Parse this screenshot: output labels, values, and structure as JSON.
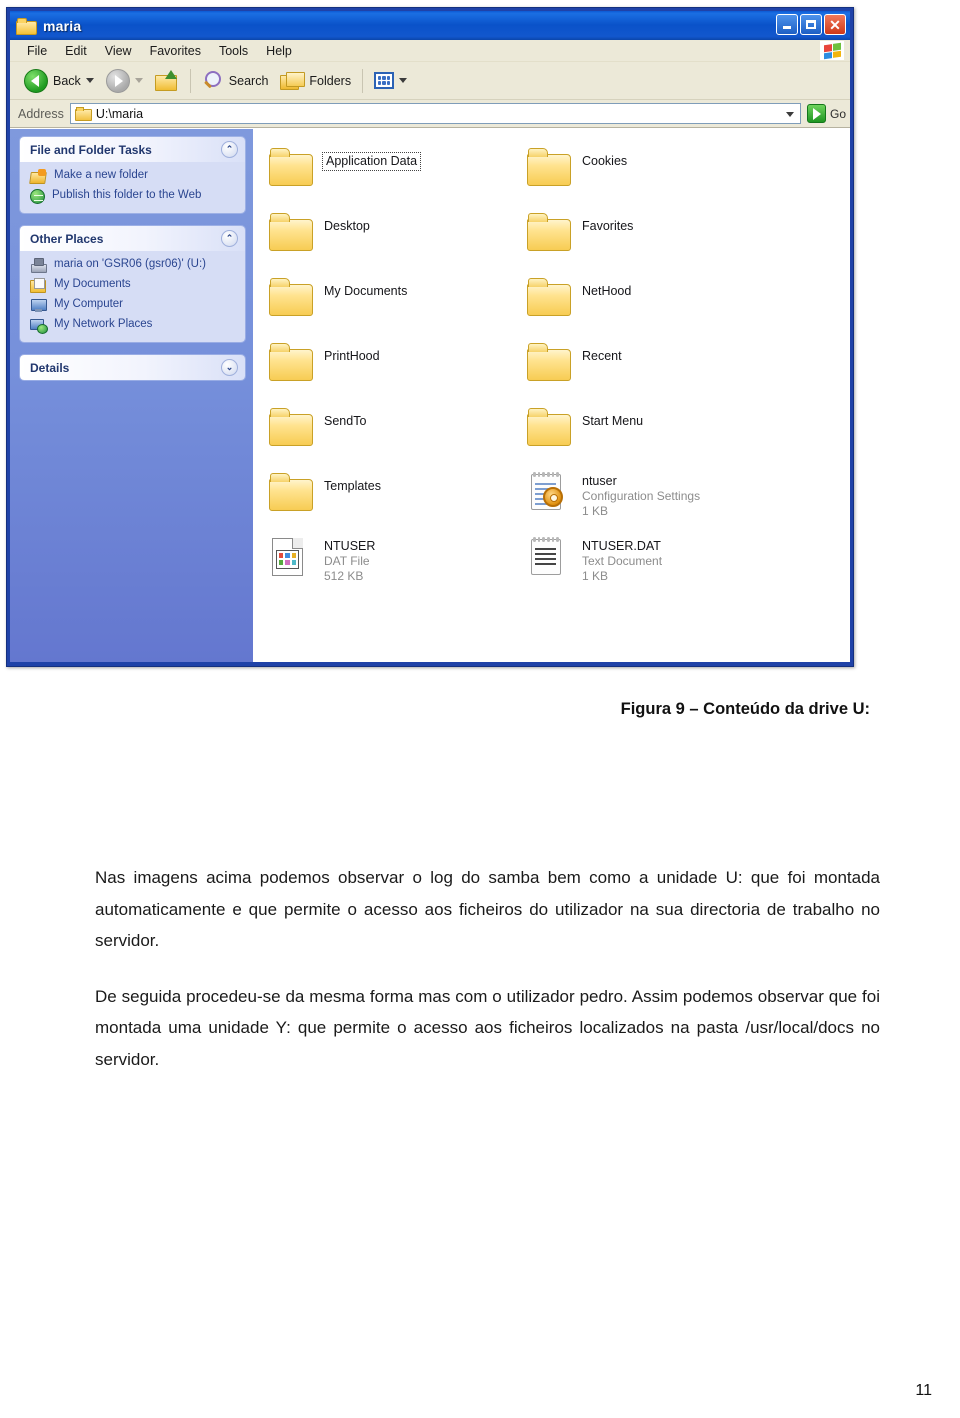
{
  "window": {
    "title": "maria",
    "controls": {
      "minimize": "–",
      "maximize": "□",
      "close": "✕"
    },
    "menus": [
      "File",
      "Edit",
      "View",
      "Favorites",
      "Tools",
      "Help"
    ],
    "toolbar": {
      "back": "Back",
      "search": "Search",
      "folders": "Folders"
    },
    "address": {
      "label": "Address",
      "value": "U:\\maria",
      "go": "Go"
    }
  },
  "sidebar": {
    "panels": [
      {
        "title": "File and Folder Tasks",
        "state": "expanded",
        "chevron": "⌃",
        "items": [
          {
            "label": "Make a new folder",
            "icon": "new-folder-icon"
          },
          {
            "label": "Publish this folder to the Web",
            "icon": "publish-web-icon"
          }
        ]
      },
      {
        "title": "Other Places",
        "state": "expanded",
        "chevron": "⌃",
        "items": [
          {
            "label": "maria on 'GSR06 (gsr06)' (U:)",
            "icon": "network-drive-icon"
          },
          {
            "label": "My Documents",
            "icon": "my-documents-icon"
          },
          {
            "label": "My Computer",
            "icon": "my-computer-icon"
          },
          {
            "label": "My Network Places",
            "icon": "network-places-icon"
          }
        ]
      },
      {
        "title": "Details",
        "state": "collapsed",
        "chevron": "⌄",
        "items": []
      }
    ]
  },
  "files": [
    {
      "name": "Application Data",
      "type": "folder",
      "focused": true,
      "meta1": "",
      "meta2": ""
    },
    {
      "name": "Cookies",
      "type": "folder",
      "focused": false,
      "meta1": "",
      "meta2": ""
    },
    {
      "name": "Desktop",
      "type": "folder",
      "focused": false,
      "meta1": "",
      "meta2": ""
    },
    {
      "name": "Favorites",
      "type": "folder",
      "focused": false,
      "meta1": "",
      "meta2": ""
    },
    {
      "name": "My Documents",
      "type": "folder",
      "focused": false,
      "meta1": "",
      "meta2": ""
    },
    {
      "name": "NetHood",
      "type": "folder",
      "focused": false,
      "meta1": "",
      "meta2": ""
    },
    {
      "name": "PrintHood",
      "type": "folder",
      "focused": false,
      "meta1": "",
      "meta2": ""
    },
    {
      "name": "Recent",
      "type": "folder",
      "focused": false,
      "meta1": "",
      "meta2": ""
    },
    {
      "name": "SendTo",
      "type": "folder",
      "focused": false,
      "meta1": "",
      "meta2": ""
    },
    {
      "name": "Start Menu",
      "type": "folder",
      "focused": false,
      "meta1": "",
      "meta2": ""
    },
    {
      "name": "Templates",
      "type": "folder",
      "focused": false,
      "meta1": "",
      "meta2": ""
    },
    {
      "name": "ntuser",
      "type": "config-settings",
      "focused": false,
      "meta1": "Configuration Settings",
      "meta2": "1 KB"
    },
    {
      "name": "NTUSER",
      "type": "dat-file",
      "focused": false,
      "meta1": "DAT File",
      "meta2": "512 KB"
    },
    {
      "name": "NTUSER.DAT",
      "type": "text-document",
      "focused": false,
      "meta1": "Text Document",
      "meta2": "1 KB"
    }
  ],
  "document": {
    "caption": "Figura 9 – Conteúdo da drive U:",
    "paragraphs": [
      "Nas imagens acima podemos observar o log do samba bem como a unidade U: que foi  montada automaticamente e que permite o acesso aos ficheiros do utilizador na sua directoria de trabalho no servidor.",
      "De seguida procedeu-se da mesma forma mas com o utilizador pedro. Assim podemos observar que foi montada uma unidade Y: que permite o acesso aos ficheiros localizados na pasta /usr/local/docs no servidor."
    ],
    "page_number": "11"
  },
  "colors": {
    "title_bar": "#0a52c9",
    "sidebar": "#7690db",
    "panel_body": "#d6ddf5",
    "panel_title_text": "#21376e",
    "chrome": "#ece9d8",
    "close_button": "#cf3818"
  }
}
